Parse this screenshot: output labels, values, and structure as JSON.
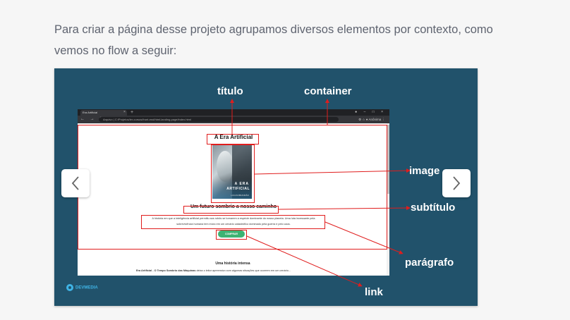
{
  "intro": "Para criar a página desse projeto agrupamos diversos elementos por contexto, como vemos no flow a seguir:",
  "labels": {
    "titulo": "título",
    "container": "container",
    "image": "image",
    "subtitulo": "subtítulo",
    "paragrafo": "parágrafo",
    "link": "link"
  },
  "browser": {
    "tab_title": "Era Artificial",
    "address": "Arquivo  |  C:/Projetos/ler-cursos/front-end/html-landing-page/index.html",
    "profile": "Anônima"
  },
  "page": {
    "title": "A Era Artificial",
    "cover_line1": "A ERA",
    "cover_line2": "ARTIFICIAL",
    "cover_author": "LUCAS BRANDÃO",
    "subtitle": "Um futuro sombrio a nosso caminho",
    "paragraph": "A história em que a inteligência artificial permitiu aos robôs se tornarem a espécie dominante do nosso planeta. Uma luta incessante pela sobrevivência humana tem início em um cenário catastrófico dominado pela guerra e pelo caos.",
    "button": "COMPRAR",
    "section_title": "Uma história intensa",
    "section_text_bold": "Era Artificial - O Tempo Sombrio das Máquinas",
    "section_text": " deixa o leitor apreensivo com algumas situações que ocorrem em um cenário..."
  },
  "logo": "DEVMEDIA",
  "icons": {
    "prev": "chevron-left-icon",
    "next": "chevron-right-icon"
  },
  "colors": {
    "slide_bg": "#21526b",
    "annotation": "#e01d1d",
    "button": "#3db373"
  }
}
